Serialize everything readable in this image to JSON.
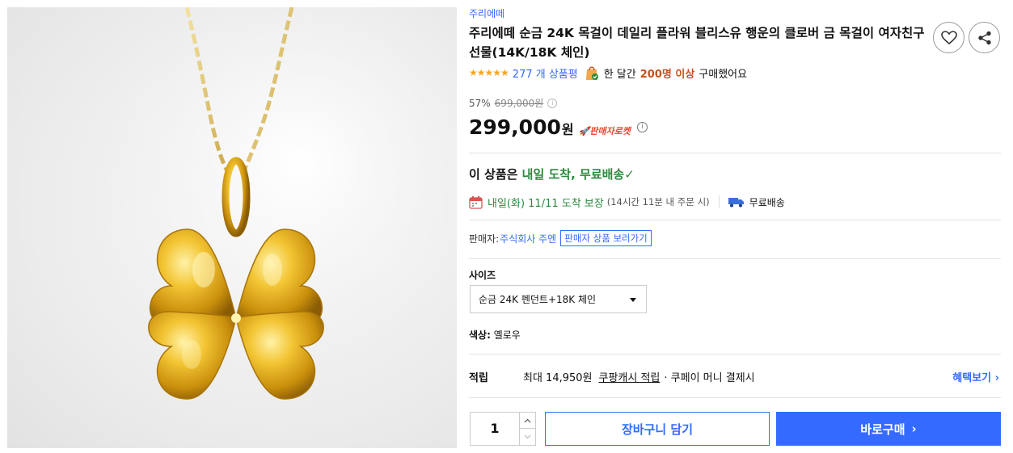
{
  "product": {
    "image_alt": "gold four-leaf clover pendant necklace",
    "brand": "주리에떼",
    "title": "주리에떼 순금 24K 목걸이 데일리 플라워 블리스유 행운의 클로버 금 목걸이 여자친구 선물(14K/18K 체인)"
  },
  "actions": {
    "favorite_icon": "heart-icon",
    "share_icon": "share-icon"
  },
  "rating": {
    "stars": "★★★★★",
    "value": 5,
    "review_count": "277 개 상품평",
    "popular_a": "한 달간",
    "popular_b": "200명 이상",
    "popular_c": "구매했어요"
  },
  "pricing": {
    "discount_rate": "57%",
    "original_price": "699,000원",
    "info_small": "i",
    "price": "299,000",
    "price_unit": "원",
    "rocket_badge": "🚀판매자로켓",
    "info_icon": "i"
  },
  "delivery": {
    "headline_prefix": "이 상품은",
    "headline_highlight": "내일 도착, 무료배송✓",
    "date_text": "내일(화) 11/11 도착 보장",
    "date_note": "(14시간 11분 내 주문 시)",
    "free_shipping": "무료배송"
  },
  "seller": {
    "label": "판매자:",
    "name": "주식회사 주엔",
    "link_label": "판매자 상품 보러가기"
  },
  "options": {
    "size_label": "사이즈",
    "size_selected": "순금 24K 펜던트+18K 체인",
    "color_label": "색상:",
    "color_value": "옐로우"
  },
  "reward": {
    "label": "적립",
    "max_text": "최대 14,950원",
    "link_text": "쿠팡캐시 적립",
    "pay_text": "· 쿠페이 머니 결제시",
    "benefit_button": "혜택보기 ›"
  },
  "purchase": {
    "quantity": "1",
    "cart_button": "장바구니 담기",
    "buy_button": "바로구매",
    "buy_chevron": "›"
  },
  "colors": {
    "accent": "#346aff",
    "green": "#2b8a3e",
    "orange": "#c7501a",
    "rocket": "#e8432e",
    "star": "#f5a623"
  }
}
